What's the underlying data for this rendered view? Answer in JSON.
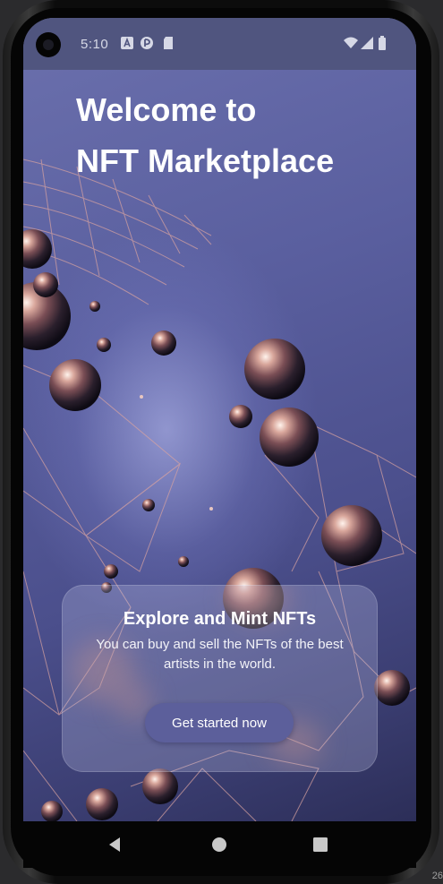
{
  "status_bar": {
    "time": "5:10",
    "left_icons": [
      "text-a-notification-icon",
      "play-protect-icon",
      "sd-card-icon"
    ],
    "right_icons": [
      "wifi-icon",
      "signal-icon",
      "battery-icon"
    ]
  },
  "hero": {
    "title_line1": "Welcome to",
    "title_line2": "NFT Marketplace"
  },
  "card": {
    "title": "Explore and Mint NFTs",
    "body": "You can buy and sell the NFTs of the best artists in the world.",
    "button_label": "Get started now"
  },
  "nav_bar": {
    "icons": [
      "back-icon",
      "home-icon",
      "recents-icon"
    ]
  },
  "edge_text": {
    "bottom_right": "26"
  },
  "colors": {
    "background_top": "#6b70ad",
    "background_bottom": "#2c2e58",
    "status_bar": "#50557f",
    "button": "#5c5f9b",
    "card": "rgba(195,198,232,0.28)",
    "text": "#ffffff"
  }
}
